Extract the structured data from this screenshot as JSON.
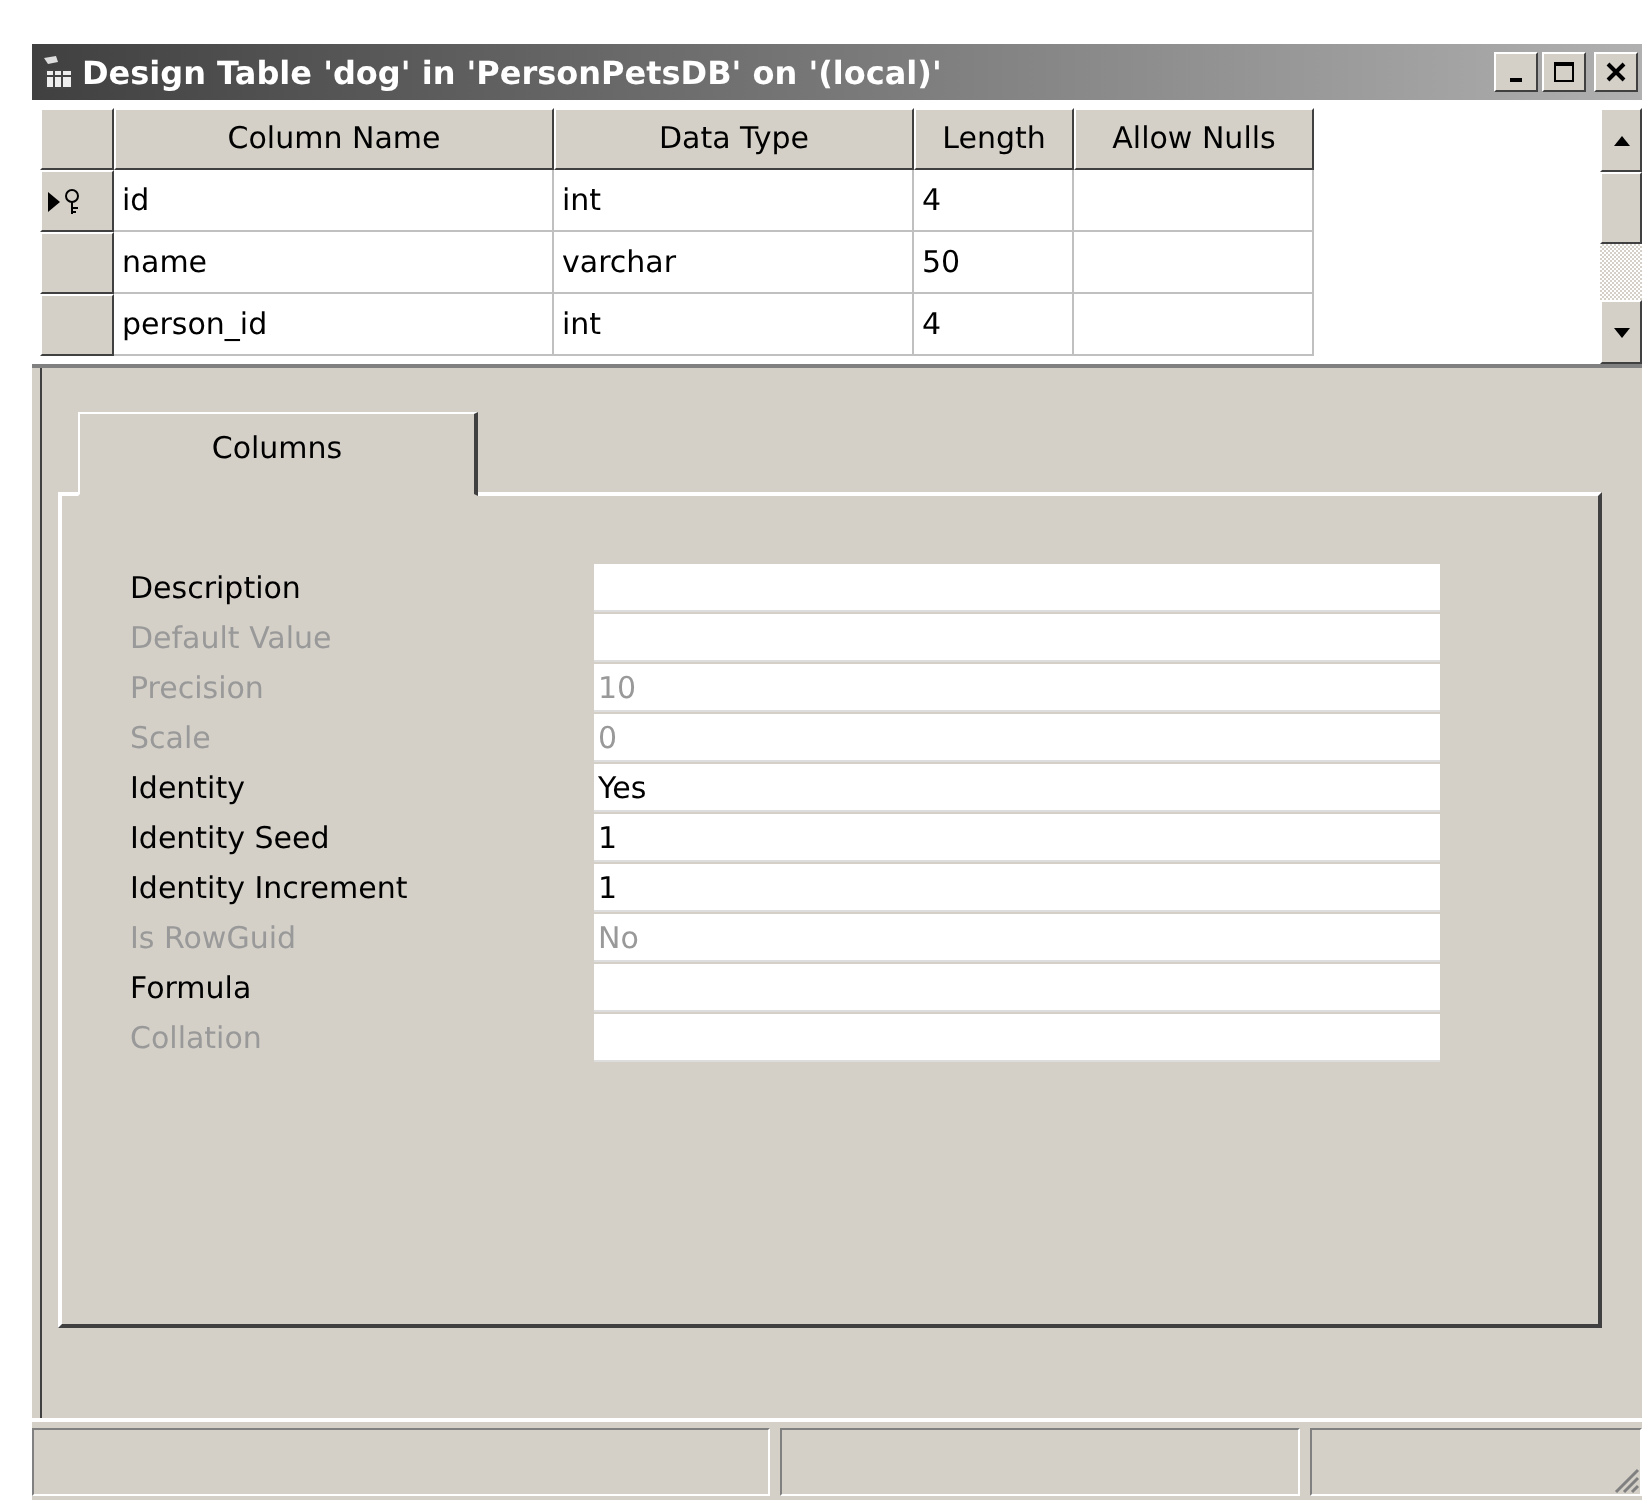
{
  "window": {
    "title": "Design Table 'dog' in 'PersonPetsDB' on '(local)'"
  },
  "grid": {
    "columns": [
      "Column Name",
      "Data Type",
      "Length",
      "Allow Nulls"
    ],
    "rows": [
      {
        "current": true,
        "primary_key": true,
        "cells": [
          "id",
          "int",
          "4",
          ""
        ]
      },
      {
        "current": false,
        "primary_key": false,
        "cells": [
          "name",
          "varchar",
          "50",
          ""
        ]
      },
      {
        "current": false,
        "primary_key": false,
        "cells": [
          "person_id",
          "int",
          "4",
          ""
        ]
      }
    ]
  },
  "tabs": [
    {
      "label": "Columns",
      "selected": true
    }
  ],
  "properties": [
    {
      "label": "Description",
      "disabled": false
    },
    {
      "label": "Default Value",
      "disabled": true
    },
    {
      "label": "Precision",
      "value": "10",
      "disabled": true
    },
    {
      "label": "Scale",
      "value": "0",
      "disabled": true
    },
    {
      "label": "Identity",
      "value": "Yes",
      "disabled": false
    },
    {
      "label": "Identity Seed",
      "value": "1",
      "disabled": false
    },
    {
      "label": "Identity Increment",
      "value": "1",
      "disabled": false
    },
    {
      "label": "Is RowGuid",
      "value": "No",
      "disabled": true
    },
    {
      "label": "Formula",
      "disabled": false
    },
    {
      "label": "Collation",
      "disabled": true
    }
  ]
}
